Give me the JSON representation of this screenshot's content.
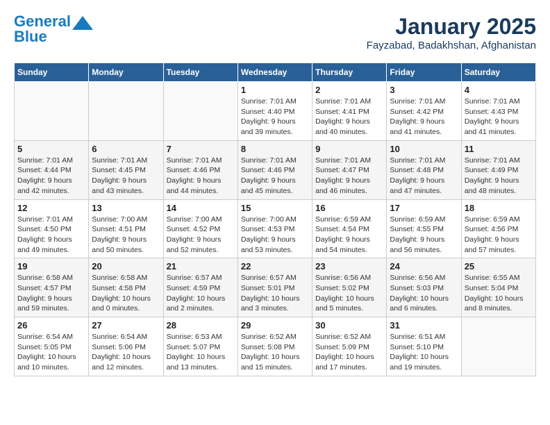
{
  "header": {
    "logo_line1": "General",
    "logo_line2": "Blue",
    "month": "January 2025",
    "location": "Fayzabad, Badakhshan, Afghanistan"
  },
  "weekdays": [
    "Sunday",
    "Monday",
    "Tuesday",
    "Wednesday",
    "Thursday",
    "Friday",
    "Saturday"
  ],
  "weeks": [
    [
      {
        "day": "",
        "info": ""
      },
      {
        "day": "",
        "info": ""
      },
      {
        "day": "",
        "info": ""
      },
      {
        "day": "1",
        "info": "Sunrise: 7:01 AM\nSunset: 4:40 PM\nDaylight: 9 hours\nand 39 minutes."
      },
      {
        "day": "2",
        "info": "Sunrise: 7:01 AM\nSunset: 4:41 PM\nDaylight: 9 hours\nand 40 minutes."
      },
      {
        "day": "3",
        "info": "Sunrise: 7:01 AM\nSunset: 4:42 PM\nDaylight: 9 hours\nand 41 minutes."
      },
      {
        "day": "4",
        "info": "Sunrise: 7:01 AM\nSunset: 4:43 PM\nDaylight: 9 hours\nand 41 minutes."
      }
    ],
    [
      {
        "day": "5",
        "info": "Sunrise: 7:01 AM\nSunset: 4:44 PM\nDaylight: 9 hours\nand 42 minutes."
      },
      {
        "day": "6",
        "info": "Sunrise: 7:01 AM\nSunset: 4:45 PM\nDaylight: 9 hours\nand 43 minutes."
      },
      {
        "day": "7",
        "info": "Sunrise: 7:01 AM\nSunset: 4:46 PM\nDaylight: 9 hours\nand 44 minutes."
      },
      {
        "day": "8",
        "info": "Sunrise: 7:01 AM\nSunset: 4:46 PM\nDaylight: 9 hours\nand 45 minutes."
      },
      {
        "day": "9",
        "info": "Sunrise: 7:01 AM\nSunset: 4:47 PM\nDaylight: 9 hours\nand 46 minutes."
      },
      {
        "day": "10",
        "info": "Sunrise: 7:01 AM\nSunset: 4:48 PM\nDaylight: 9 hours\nand 47 minutes."
      },
      {
        "day": "11",
        "info": "Sunrise: 7:01 AM\nSunset: 4:49 PM\nDaylight: 9 hours\nand 48 minutes."
      }
    ],
    [
      {
        "day": "12",
        "info": "Sunrise: 7:01 AM\nSunset: 4:50 PM\nDaylight: 9 hours\nand 49 minutes."
      },
      {
        "day": "13",
        "info": "Sunrise: 7:00 AM\nSunset: 4:51 PM\nDaylight: 9 hours\nand 50 minutes."
      },
      {
        "day": "14",
        "info": "Sunrise: 7:00 AM\nSunset: 4:52 PM\nDaylight: 9 hours\nand 52 minutes."
      },
      {
        "day": "15",
        "info": "Sunrise: 7:00 AM\nSunset: 4:53 PM\nDaylight: 9 hours\nand 53 minutes."
      },
      {
        "day": "16",
        "info": "Sunrise: 6:59 AM\nSunset: 4:54 PM\nDaylight: 9 hours\nand 54 minutes."
      },
      {
        "day": "17",
        "info": "Sunrise: 6:59 AM\nSunset: 4:55 PM\nDaylight: 9 hours\nand 56 minutes."
      },
      {
        "day": "18",
        "info": "Sunrise: 6:59 AM\nSunset: 4:56 PM\nDaylight: 9 hours\nand 57 minutes."
      }
    ],
    [
      {
        "day": "19",
        "info": "Sunrise: 6:58 AM\nSunset: 4:57 PM\nDaylight: 9 hours\nand 59 minutes."
      },
      {
        "day": "20",
        "info": "Sunrise: 6:58 AM\nSunset: 4:58 PM\nDaylight: 10 hours\nand 0 minutes."
      },
      {
        "day": "21",
        "info": "Sunrise: 6:57 AM\nSunset: 4:59 PM\nDaylight: 10 hours\nand 2 minutes."
      },
      {
        "day": "22",
        "info": "Sunrise: 6:57 AM\nSunset: 5:01 PM\nDaylight: 10 hours\nand 3 minutes."
      },
      {
        "day": "23",
        "info": "Sunrise: 6:56 AM\nSunset: 5:02 PM\nDaylight: 10 hours\nand 5 minutes."
      },
      {
        "day": "24",
        "info": "Sunrise: 6:56 AM\nSunset: 5:03 PM\nDaylight: 10 hours\nand 6 minutes."
      },
      {
        "day": "25",
        "info": "Sunrise: 6:55 AM\nSunset: 5:04 PM\nDaylight: 10 hours\nand 8 minutes."
      }
    ],
    [
      {
        "day": "26",
        "info": "Sunrise: 6:54 AM\nSunset: 5:05 PM\nDaylight: 10 hours\nand 10 minutes."
      },
      {
        "day": "27",
        "info": "Sunrise: 6:54 AM\nSunset: 5:06 PM\nDaylight: 10 hours\nand 12 minutes."
      },
      {
        "day": "28",
        "info": "Sunrise: 6:53 AM\nSunset: 5:07 PM\nDaylight: 10 hours\nand 13 minutes."
      },
      {
        "day": "29",
        "info": "Sunrise: 6:52 AM\nSunset: 5:08 PM\nDaylight: 10 hours\nand 15 minutes."
      },
      {
        "day": "30",
        "info": "Sunrise: 6:52 AM\nSunset: 5:09 PM\nDaylight: 10 hours\nand 17 minutes."
      },
      {
        "day": "31",
        "info": "Sunrise: 6:51 AM\nSunset: 5:10 PM\nDaylight: 10 hours\nand 19 minutes."
      },
      {
        "day": "",
        "info": ""
      }
    ]
  ]
}
